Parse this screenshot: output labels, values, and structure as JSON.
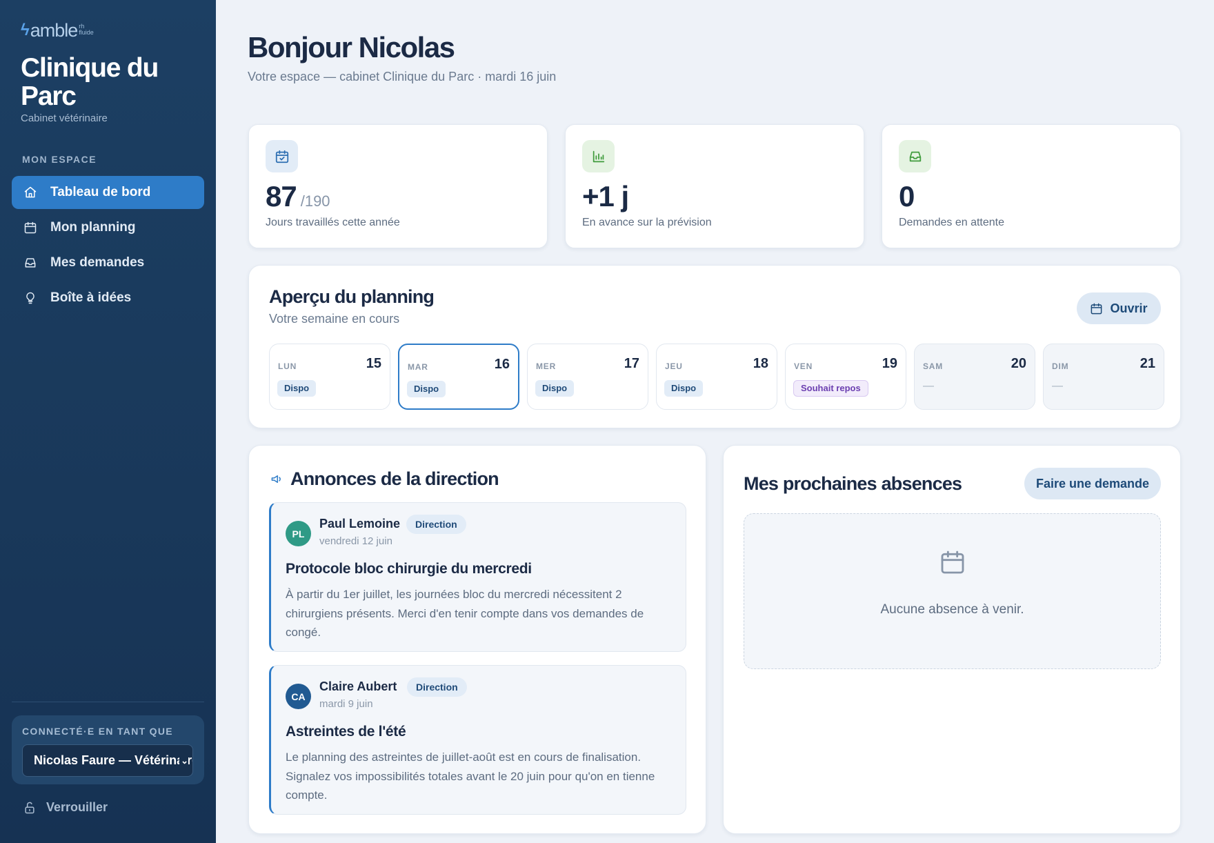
{
  "brand": {
    "name": "amble",
    "sub1": "rh",
    "sub2": "fluide"
  },
  "clinic": {
    "name": "Clinique du Parc",
    "type": "Cabinet vétérinaire"
  },
  "sidebar": {
    "section_label": "MON ESPACE",
    "items": [
      {
        "label": "Tableau de bord",
        "icon": "home-icon",
        "active": true
      },
      {
        "label": "Mon planning",
        "icon": "calendar-icon",
        "active": false
      },
      {
        "label": "Mes demandes",
        "icon": "inbox-icon",
        "active": false
      },
      {
        "label": "Boîte à idées",
        "icon": "lightbulb-icon",
        "active": false
      }
    ],
    "connected_label": "CONNECTÉ·E EN TANT QUE",
    "current_user": "Nicolas Faure — Vétérinaire",
    "lock_label": "Verrouiller"
  },
  "header": {
    "greeting": "Bonjour Nicolas",
    "subtitle": "Votre espace — cabinet Clinique du Parc · mardi 16 juin"
  },
  "stats": [
    {
      "value": "87",
      "total": "/190",
      "label": "Jours travaillés cette année",
      "icon": "calendar-check-icon",
      "color": "#2e6fb2",
      "bg": "#e2ecf7"
    },
    {
      "value": "+1 j",
      "total": "",
      "label": "En avance sur la prévision",
      "icon": "bar-chart-icon",
      "color": "#3f9b3c",
      "bg": "#e5f3e2"
    },
    {
      "value": "0",
      "total": "",
      "label": "Demandes en attente",
      "icon": "inbox-icon",
      "color": "#3f9b3c",
      "bg": "#e5f3e2"
    }
  ],
  "planning": {
    "title": "Aperçu du planning",
    "subtitle": "Votre semaine en cours",
    "open_label": "Ouvrir",
    "days": [
      {
        "name": "LUN",
        "num": "15",
        "status": "Dispo",
        "kind": "dispo"
      },
      {
        "name": "MAR",
        "num": "16",
        "status": "Dispo",
        "kind": "dispo",
        "today": true
      },
      {
        "name": "MER",
        "num": "17",
        "status": "Dispo",
        "kind": "dispo"
      },
      {
        "name": "JEU",
        "num": "18",
        "status": "Dispo",
        "kind": "dispo"
      },
      {
        "name": "VEN",
        "num": "19",
        "status": "Souhait repos",
        "kind": "repos"
      },
      {
        "name": "SAM",
        "num": "20",
        "status": "—",
        "kind": "weekend"
      },
      {
        "name": "DIM",
        "num": "21",
        "status": "—",
        "kind": "weekend"
      }
    ]
  },
  "announcements": {
    "title": "Annonces de la direction",
    "items": [
      {
        "initials": "PL",
        "avatar_color": "#2f9a86",
        "author": "Paul Lemoine",
        "role": "Direction",
        "date": "vendredi 12 juin",
        "title": "Protocole bloc chirurgie du mercredi",
        "body": "À partir du 1er juillet, les journées bloc du mercredi nécessitent 2 chirurgiens présents. Merci d'en tenir compte dans vos demandes de congé."
      },
      {
        "initials": "CA",
        "avatar_color": "#215a92",
        "author": "Claire Aubert",
        "role": "Direction",
        "date": "mardi 9 juin",
        "title": "Astreintes de l'été",
        "body": "Le planning des astreintes de juillet-août est en cours de finalisation. Signalez vos impossibilités totales avant le 20 juin pour qu'on en tienne compte."
      }
    ]
  },
  "absences": {
    "title": "Mes prochaines absences",
    "request_label": "Faire une demande",
    "empty_text": "Aucune absence à venir."
  }
}
